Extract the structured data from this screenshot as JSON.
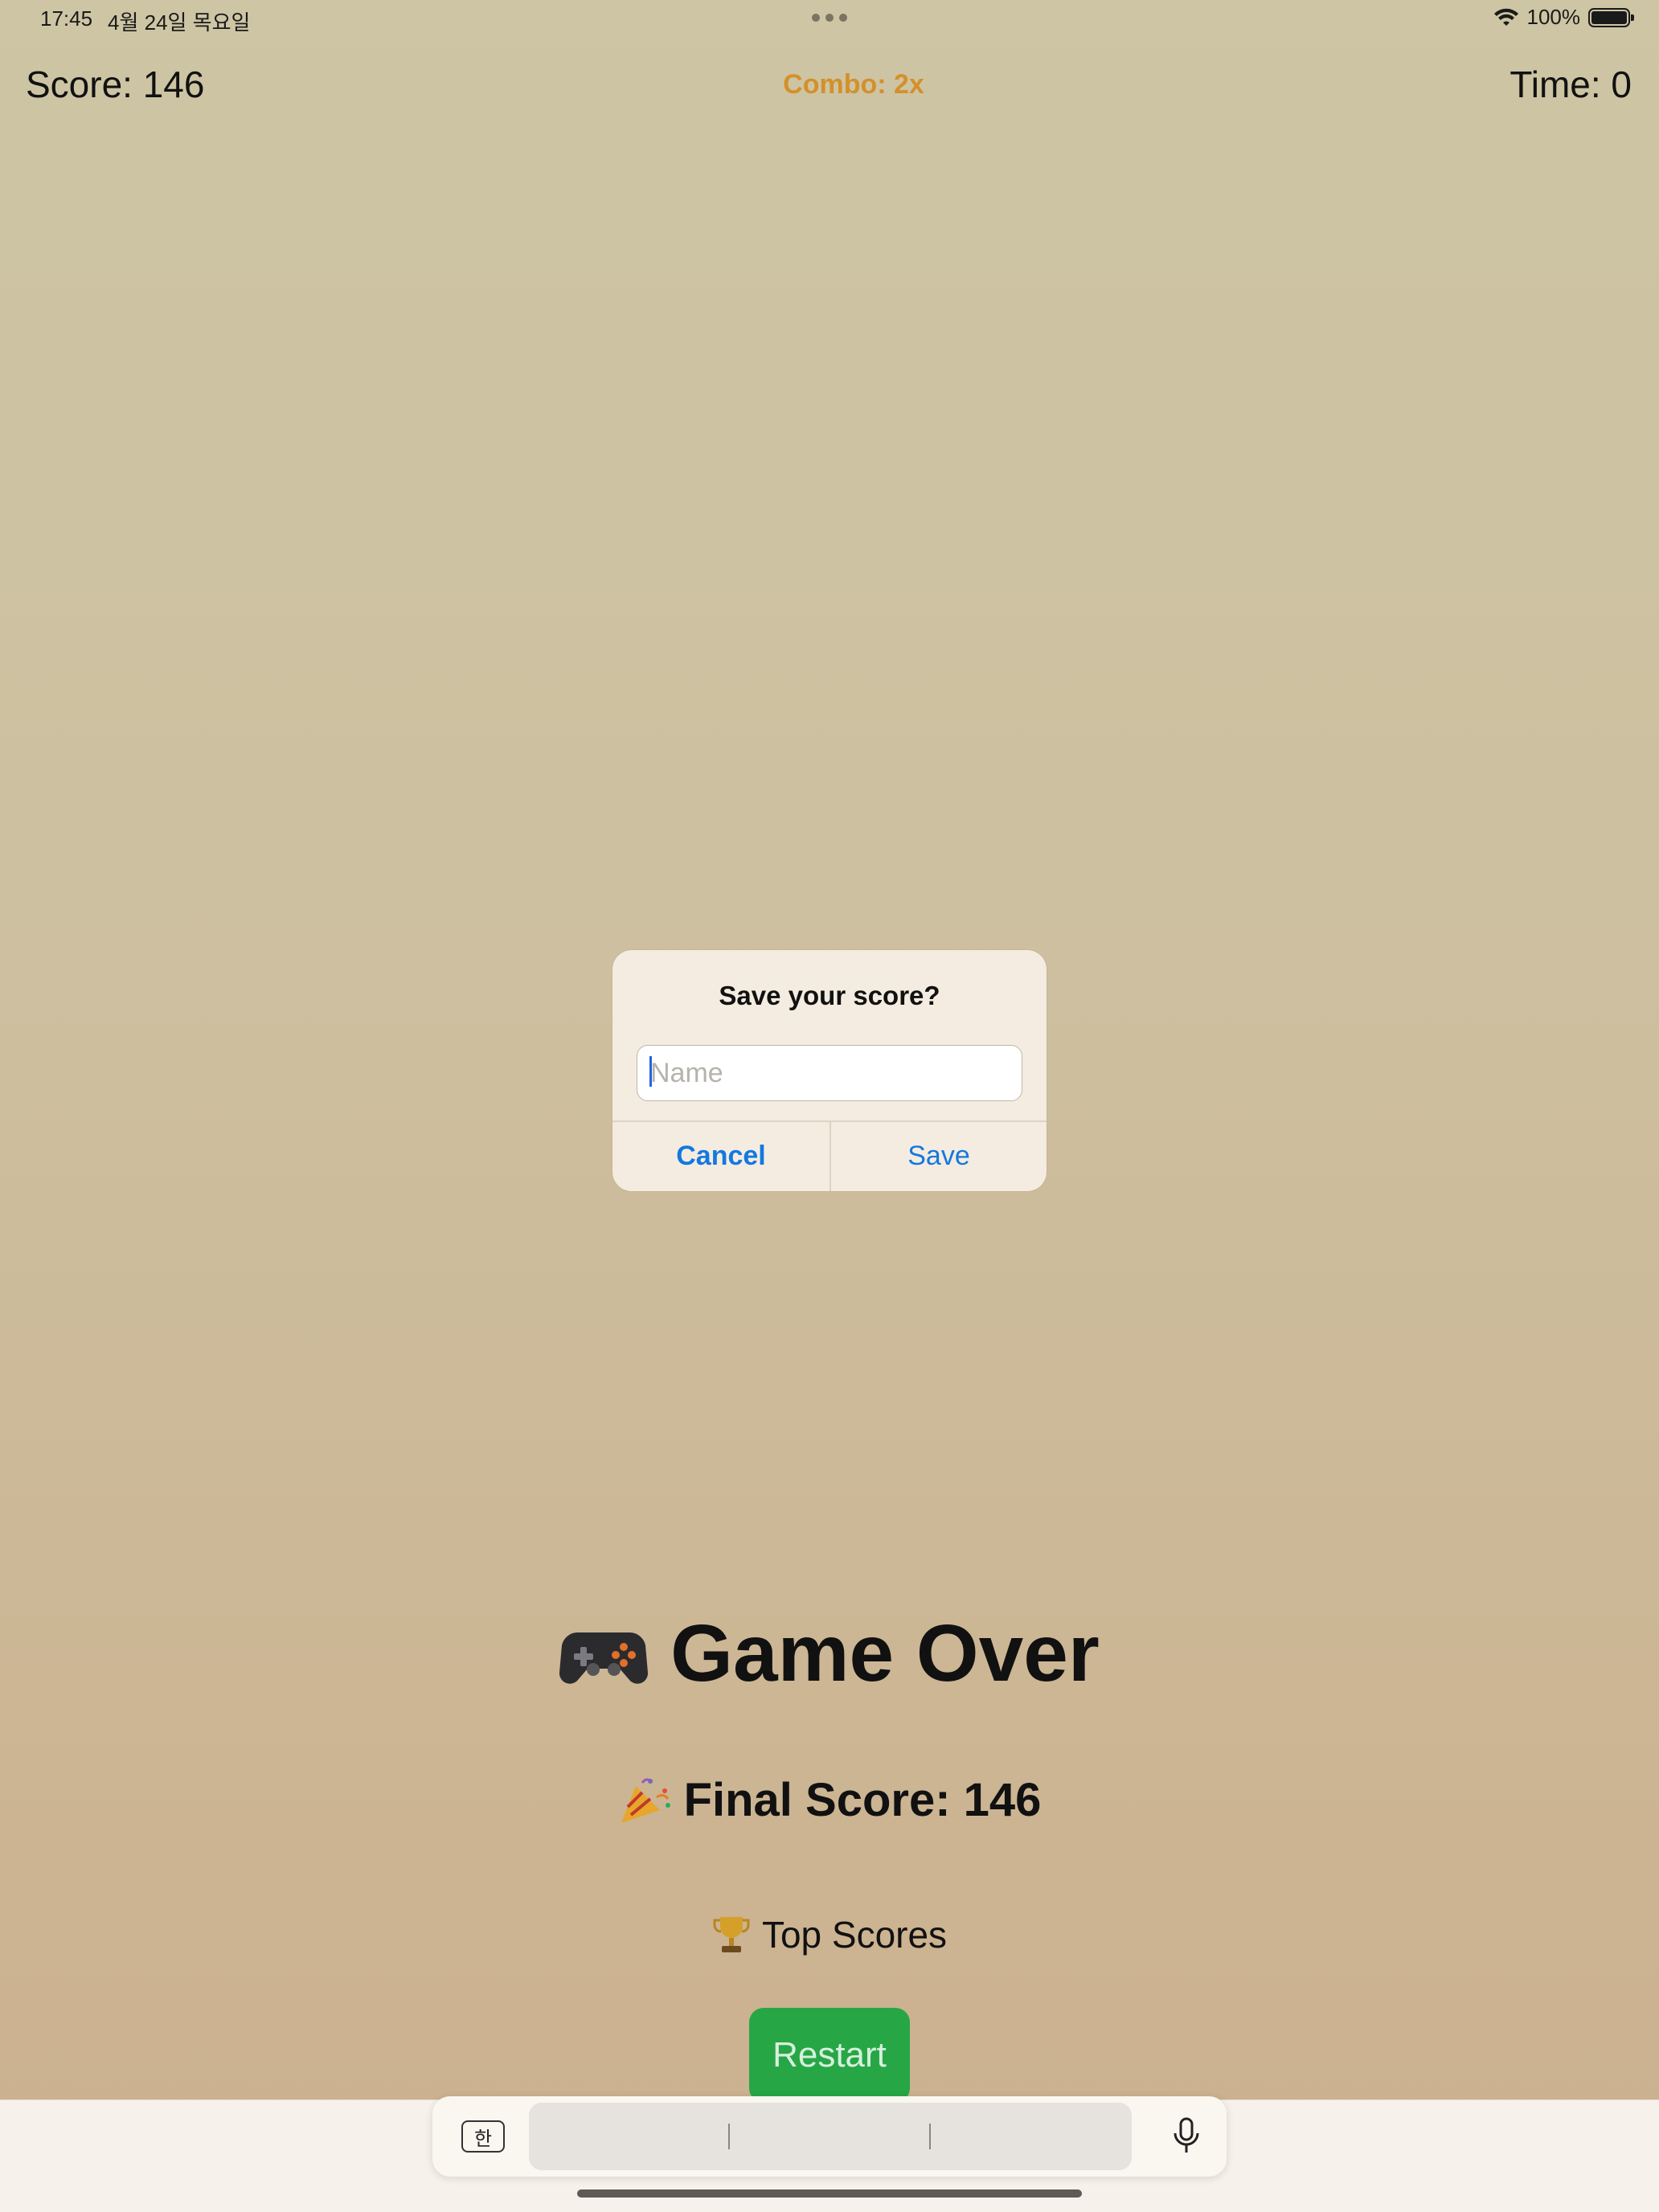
{
  "status_bar": {
    "time": "17:45",
    "date": "4월 24일 목요일",
    "battery": "100%"
  },
  "hud": {
    "score": "Score: 146",
    "combo": "Combo: 2x",
    "time": "Time: 0"
  },
  "dialog": {
    "title": "Save your score?",
    "input_value": "",
    "input_placeholder": "Name",
    "cancel_label": "Cancel",
    "save_label": "Save"
  },
  "game_over": {
    "title": "Game Over",
    "title_icon": "gamepad-icon",
    "final_score": "Final Score: 146",
    "final_score_icon": "party-popper-icon",
    "top_scores": "Top Scores",
    "top_scores_icon": "trophy-icon",
    "restart_label": "Restart"
  },
  "keyboard": {
    "lang_key": "한",
    "mic_icon": "microphone-icon"
  },
  "colors": {
    "combo": "#d4902a",
    "accent_blue": "#1478e0",
    "restart_green": "#27a646",
    "dialog_bg": "#f4ece0"
  }
}
